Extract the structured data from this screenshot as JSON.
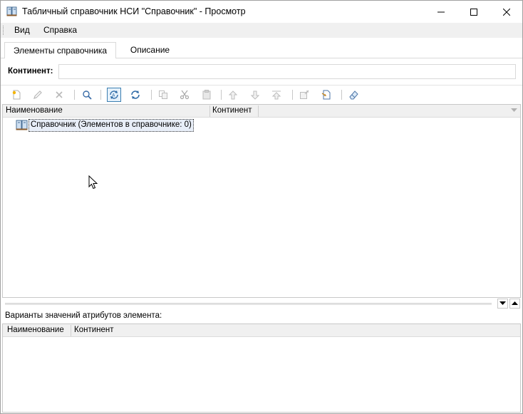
{
  "window": {
    "title": "Табличный справочник НСИ \"Справочник\" - Просмотр"
  },
  "menu": {
    "items": [
      {
        "label": "Вид"
      },
      {
        "label": "Справка"
      }
    ]
  },
  "tabs": [
    {
      "label": "Элементы справочника",
      "active": true
    },
    {
      "label": "Описание",
      "active": false
    }
  ],
  "filter": {
    "label": "Континент:",
    "value": ""
  },
  "toolbar": {
    "icons": [
      "new-element-icon",
      "edit-icon",
      "delete-icon",
      "find-icon",
      "auto-refresh-icon",
      "refresh-icon",
      "copy-icon",
      "cut-icon",
      "paste-icon",
      "move-up-icon",
      "move-down-icon",
      "move-top-icon",
      "export-icon",
      "import-icon",
      "eraser-icon"
    ]
  },
  "grid": {
    "columns": [
      "Наименование",
      "Континент"
    ],
    "rows": [
      {
        "label": "Справочник (Элементов в справочнике: 0)",
        "icon": "book-icon"
      }
    ]
  },
  "attributes": {
    "label": "Варианты значений атрибутов элемента:",
    "columns": [
      "Наименование",
      "Континент"
    ]
  },
  "colors": {
    "menubar": "#f0f0f0",
    "header": "#f0f0f0",
    "selection": "#e8eef8",
    "accent": "#3c7fb1"
  }
}
